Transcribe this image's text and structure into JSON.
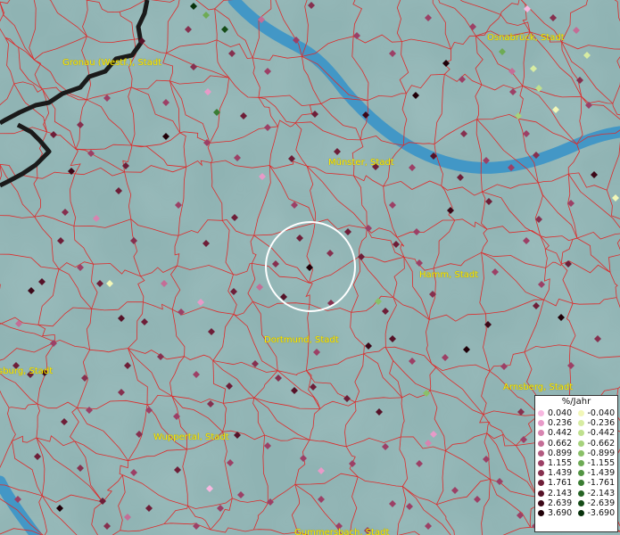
{
  "cities": [
    {
      "id": "gronau",
      "name": "Gronau (Westf.), Stadt"
    },
    {
      "id": "osnabrueck",
      "name": "Osnabrück, Stadt"
    },
    {
      "id": "muenster",
      "name": "Münster, Stadt"
    },
    {
      "id": "hamm",
      "name": "Hamm, Stadt"
    },
    {
      "id": "dortmund",
      "name": "Dortmund, Stadt"
    },
    {
      "id": "duisburg",
      "name": "sburg, Stadt"
    },
    {
      "id": "arnsberg",
      "name": "Arnsberg, Stadt"
    },
    {
      "id": "wuppertal",
      "name": "Wuppertal, Stadt"
    },
    {
      "id": "gummersbach",
      "name": "Gummersbach, Stadt"
    }
  ],
  "legend": {
    "title": "%/Jahr",
    "positive": [
      {
        "label": "0.040",
        "color": "#f7b8e0"
      },
      {
        "label": "0.236",
        "color": "#e79ac8"
      },
      {
        "label": "0.442",
        "color": "#d784b0"
      },
      {
        "label": "0.662",
        "color": "#c46d96"
      },
      {
        "label": "0.899",
        "color": "#b25a80"
      },
      {
        "label": "1.155",
        "color": "#9c4066"
      },
      {
        "label": "1.439",
        "color": "#86304f"
      },
      {
        "label": "1.761",
        "color": "#6e1e38"
      },
      {
        "label": "2.143",
        "color": "#561228"
      },
      {
        "label": "2.639",
        "color": "#3c0818"
      },
      {
        "label": "3.690",
        "color": "#200008"
      }
    ],
    "negative": [
      {
        "label": "-0.040",
        "color": "#f2f7b8"
      },
      {
        "label": "-0.236",
        "color": "#d7eca2"
      },
      {
        "label": "-0.442",
        "color": "#bfe08e"
      },
      {
        "label": "-0.662",
        "color": "#a6d27c"
      },
      {
        "label": "-0.899",
        "color": "#8ac068"
      },
      {
        "label": "-1.155",
        "color": "#6eab55"
      },
      {
        "label": "-1.439",
        "color": "#539543"
      },
      {
        "label": "-1.761",
        "color": "#3b7d33"
      },
      {
        "label": "-2.143",
        "color": "#276425"
      },
      {
        "label": "-2.639",
        "color": "#164c18"
      },
      {
        "label": "-3.690",
        "color": "#08320c"
      }
    ]
  },
  "styles": {
    "background": "#8fb3b3",
    "river": "#3a94c8",
    "border": "#dd2b2b",
    "country_border": "#1a1a1a",
    "label_color": "#ffee00"
  },
  "layers": [
    "terrain-background",
    "river",
    "administrative-boundaries",
    "country-border",
    "data-points",
    "focus-circle"
  ],
  "highlight": {
    "type": "circle",
    "color": "#ffffff"
  }
}
